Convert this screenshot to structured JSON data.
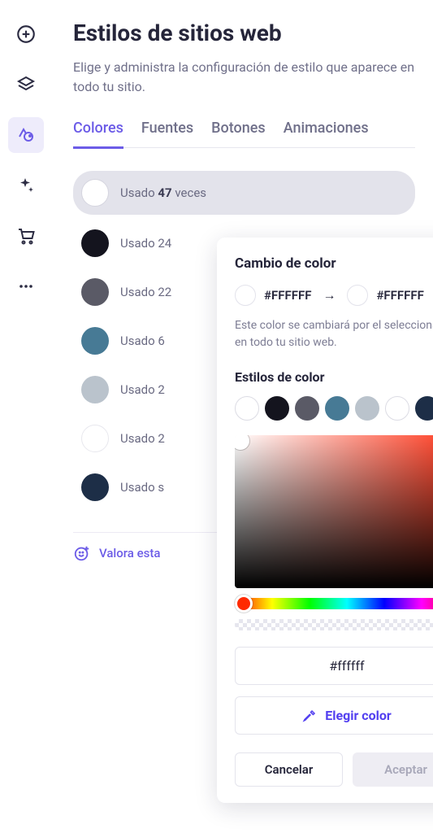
{
  "page": {
    "title": "Estilos de sitios web",
    "description": "Elige y administra la configuración de estilo que aparece en todo tu sitio."
  },
  "tabs": {
    "colors": "Colores",
    "fonts": "Fuentes",
    "buttons": "Botones",
    "animations": "Animaciones"
  },
  "colors": {
    "used_label": "Usado",
    "times_label": "veces",
    "items": [
      {
        "count": "47",
        "color": "#FFFFFF"
      },
      {
        "count": "24",
        "color": "#14141E"
      },
      {
        "count": "22",
        "color": "#5A5A66"
      },
      {
        "count": "6",
        "color": "#477A95"
      },
      {
        "count": "2",
        "color": "#BAC3CC"
      },
      {
        "count": "2",
        "color": "#FFFFFF"
      },
      {
        "count": "",
        "color": "#1D2E47"
      }
    ],
    "row1_text": "Usado 47 veces",
    "row2_text": "Usado 24",
    "row3_text": "Usado 22",
    "row4_text": "Usado 6",
    "row5_text": "Usado 2",
    "row6_text": "Usado 2",
    "row7_text": "Usado s"
  },
  "rate_label": "Valora esta",
  "popover": {
    "title": "Cambio de color",
    "from_hex": "#FFFFFF",
    "to_hex": "#FFFFFF",
    "desc": "Este color se cambiará por el seleccionado en todo tu sitio web.",
    "styles_title": "Estilos de color",
    "palette": [
      "#FFFFFF",
      "#14141E",
      "#5A5A66",
      "#477A95",
      "#BAC3CC",
      "#FFFFFF",
      "#1D2E47"
    ],
    "hex_value": "#ffffff",
    "pick_label": "Elegir color",
    "cancel_label": "Cancelar",
    "accept_label": "Aceptar"
  }
}
